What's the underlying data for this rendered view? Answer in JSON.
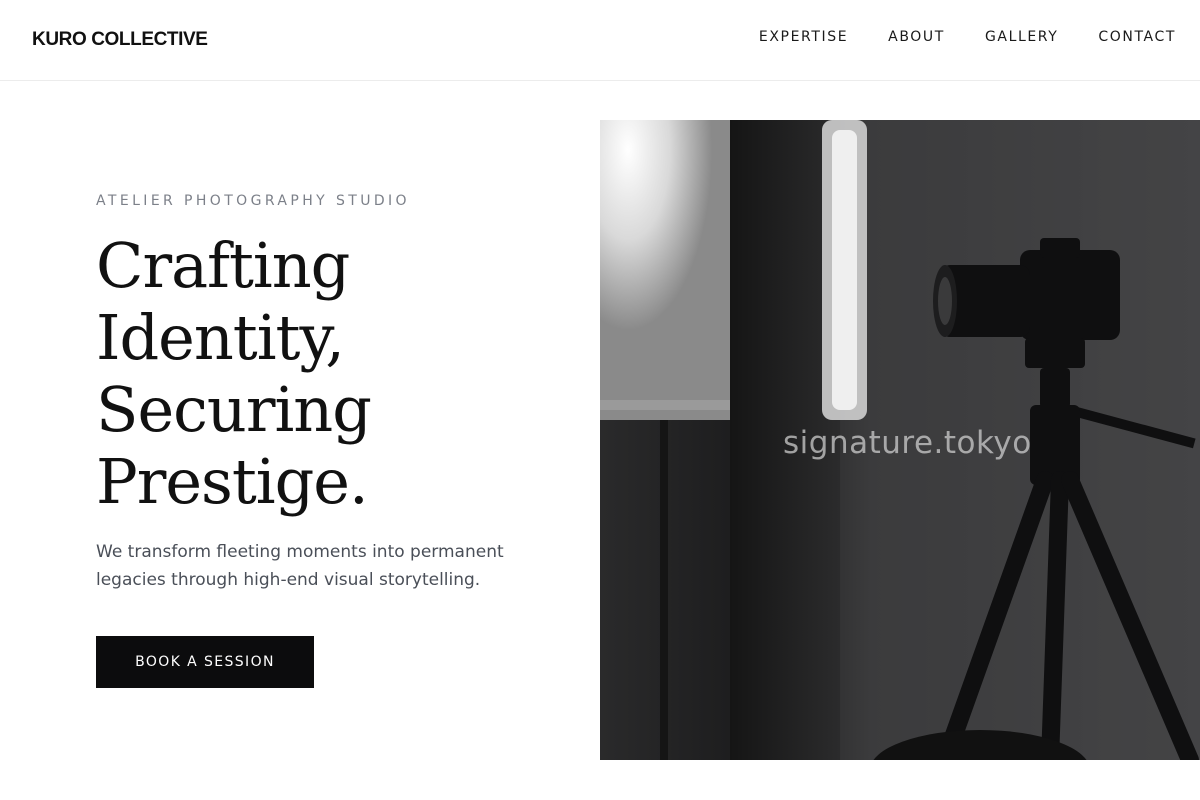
{
  "header": {
    "brand": "KURO COLLECTIVE",
    "nav": [
      "EXPERTISE",
      "ABOUT",
      "GALLERY",
      "CONTACT"
    ]
  },
  "hero": {
    "eyebrow": "ATELIER PHOTOGRAPHY STUDIO",
    "headline": [
      "Crafting",
      "Identity,",
      "Securing",
      "Prestige."
    ],
    "subtext": "We transform fleeting moments into permanent legacies through high-end visual storytelling.",
    "cta_label": "BOOK A SESSION",
    "image": {
      "watermark": "signature.tokyo",
      "subject": "camera on tripod beside softbox light in monochrome studio"
    }
  },
  "colors": {
    "text": "#111111",
    "muted": "#7c8089",
    "body_text": "#4a4f58",
    "button_bg": "#0c0c0d",
    "button_text": "#ffffff",
    "divider": "#ececec"
  }
}
